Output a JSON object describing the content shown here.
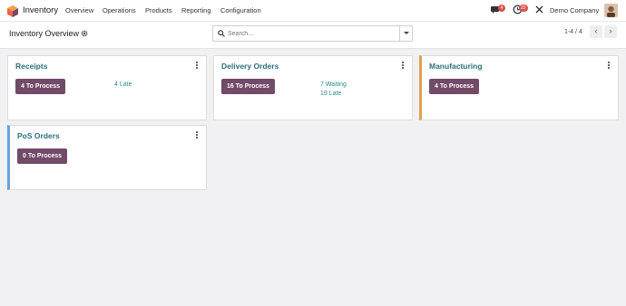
{
  "app": {
    "name": "Inventory"
  },
  "nav": {
    "menu": [
      "Overview",
      "Operations",
      "Products",
      "Reporting",
      "Configuration"
    ],
    "discuss_badge": "4",
    "activity_badge": "22",
    "company": "Demo Company"
  },
  "control": {
    "title": "Inventory Overview",
    "search_placeholder": "Search...",
    "pager": "1-4 / 4"
  },
  "cards": [
    {
      "title": "Receipts",
      "button": "4 To Process",
      "stats": [
        "4 Late"
      ],
      "accent": ""
    },
    {
      "title": "Delivery Orders",
      "button": "16 To Process",
      "stats": [
        "7 Waiting",
        "19 Late"
      ],
      "accent": ""
    },
    {
      "title": "Manufacturing",
      "button": "4 To Process",
      "stats": [],
      "accent": "#e0a050"
    },
    {
      "title": "PoS Orders",
      "button": "0 To Process",
      "stats": [],
      "accent": "#6aa0e0"
    }
  ],
  "colors": {
    "brand": "#714b67",
    "title": "#2b6f7d",
    "stat": "#2b8a8f"
  }
}
